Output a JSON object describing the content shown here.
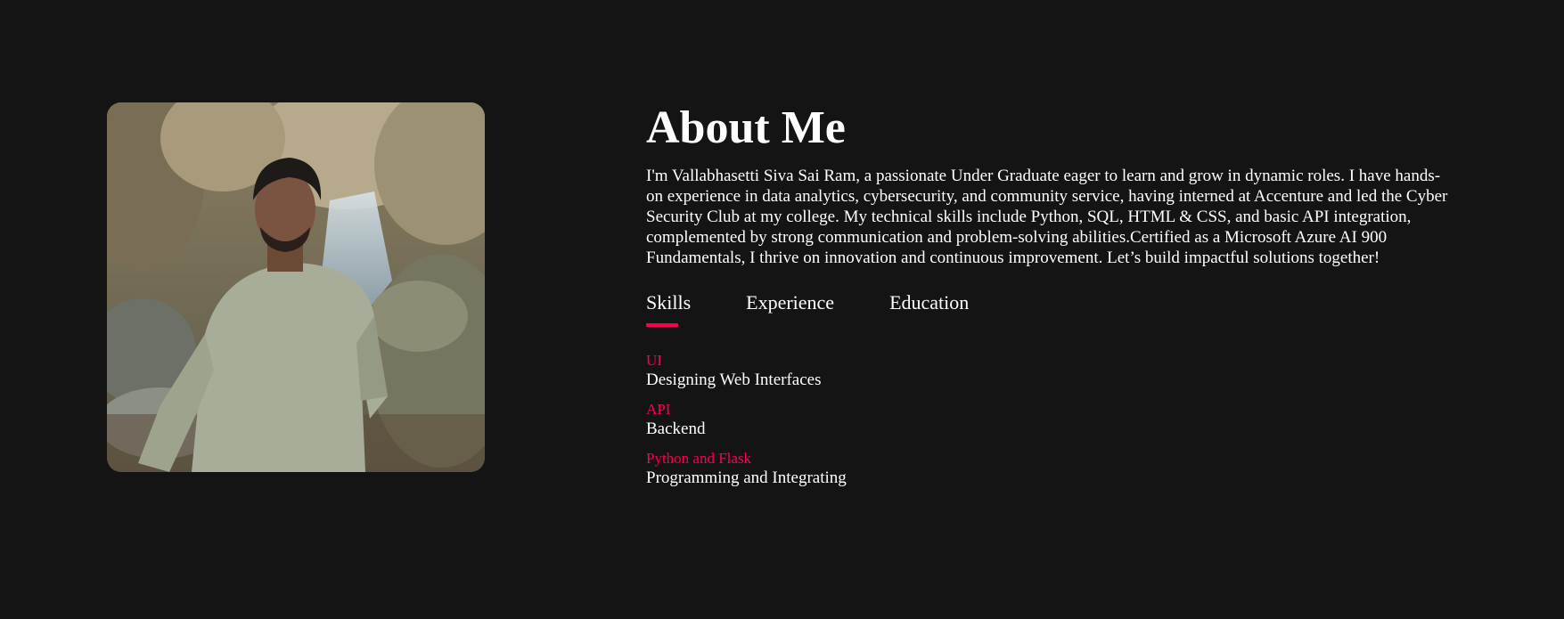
{
  "about": {
    "title": "About Me",
    "bio": "I'm Vallabhasetti Siva Sai Ram, a passionate Under Graduate eager to learn and grow in dynamic roles. I have hands-on experience in data analytics, cybersecurity, and community service, having interned at Accenture and led the Cyber Security Club at my college. My technical skills include Python, SQL, HTML & CSS, and basic API integration, complemented by strong communication and problem-solving abilities.Certified as a Microsoft Azure AI 900 Fundamentals, I thrive on innovation and continuous improvement. Let’s build impactful solutions together!"
  },
  "tabs": [
    {
      "label": "Skills",
      "active": true
    },
    {
      "label": "Experience",
      "active": false
    },
    {
      "label": "Education",
      "active": false
    }
  ],
  "skills": [
    {
      "name": "UI",
      "description": "Designing Web Interfaces"
    },
    {
      "name": "API",
      "description": "Backend"
    },
    {
      "name": "Python and Flask",
      "description": "Programming and Integrating"
    }
  ],
  "colors": {
    "background": "#141414",
    "accent": "#ff004f",
    "text": "#ffffff"
  }
}
